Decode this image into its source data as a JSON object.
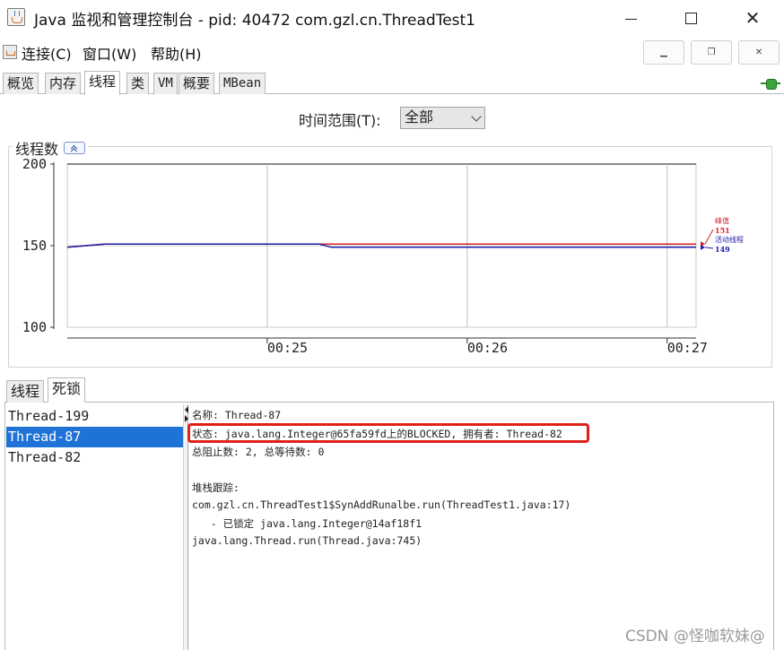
{
  "window": {
    "title": "Java 监视和管理控制台 - pid: 40472 com.gzl.cn.ThreadTest1"
  },
  "menu": {
    "items": [
      "连接(C)",
      "窗口(W)",
      "帮助(H)"
    ]
  },
  "tabs": [
    {
      "label": "概览",
      "active": false
    },
    {
      "label": "内存",
      "active": false
    },
    {
      "label": "线程",
      "active": true
    },
    {
      "label": "类",
      "active": false
    },
    {
      "label": "VM",
      "active": false
    },
    {
      "label": "概要",
      "active": false
    },
    {
      "label": "MBean",
      "active": false
    }
  ],
  "time_range": {
    "label": "时间范围(T):",
    "selected": "全部"
  },
  "chart_data": {
    "type": "line",
    "title": "线程数",
    "ylim": [
      100,
      200
    ],
    "yticks": [
      100,
      150,
      200
    ],
    "xtick_labels": [
      "00:25",
      "00:26",
      "00:27"
    ],
    "xticks": [
      0.318,
      0.636,
      0.954
    ],
    "grid": true,
    "series": [
      {
        "name": "峰值",
        "color": "#d9252a",
        "value_label": "151",
        "x": [
          0,
          0.03,
          0.06,
          0.4,
          1.0
        ],
        "y": [
          149,
          150,
          151,
          151,
          151
        ]
      },
      {
        "name": "活动线程",
        "color": "#1c1ca8",
        "value_label": "149",
        "x": [
          0,
          0.03,
          0.06,
          0.4,
          0.42,
          1.0
        ],
        "y": [
          149,
          150,
          151,
          151,
          149,
          149
        ]
      }
    ]
  },
  "lower_tabs": [
    {
      "label": "线程",
      "active": false
    },
    {
      "label": "死锁",
      "active": true
    }
  ],
  "threads": [
    {
      "name": "Thread-199",
      "selected": false
    },
    {
      "name": "Thread-87",
      "selected": true
    },
    {
      "name": "Thread-82",
      "selected": false
    }
  ],
  "details": {
    "name_line": "名称: Thread-87",
    "state_line": "状态: java.lang.Integer@65fa59fd上的BLOCKED, 拥有者: Thread-82",
    "blocked_line": "总阻止数: 2, 总等待数: 0",
    "stack_header": "堆栈跟踪:",
    "stack": [
      "com.gzl.cn.ThreadTest1$SynAddRunalbe.run(ThreadTest1.java:17)",
      "   - 已锁定 java.lang.Integer@14af18f1",
      "java.lang.Thread.run(Thread.java:745)"
    ]
  },
  "watermark": "CSDN @怪咖软妹@"
}
